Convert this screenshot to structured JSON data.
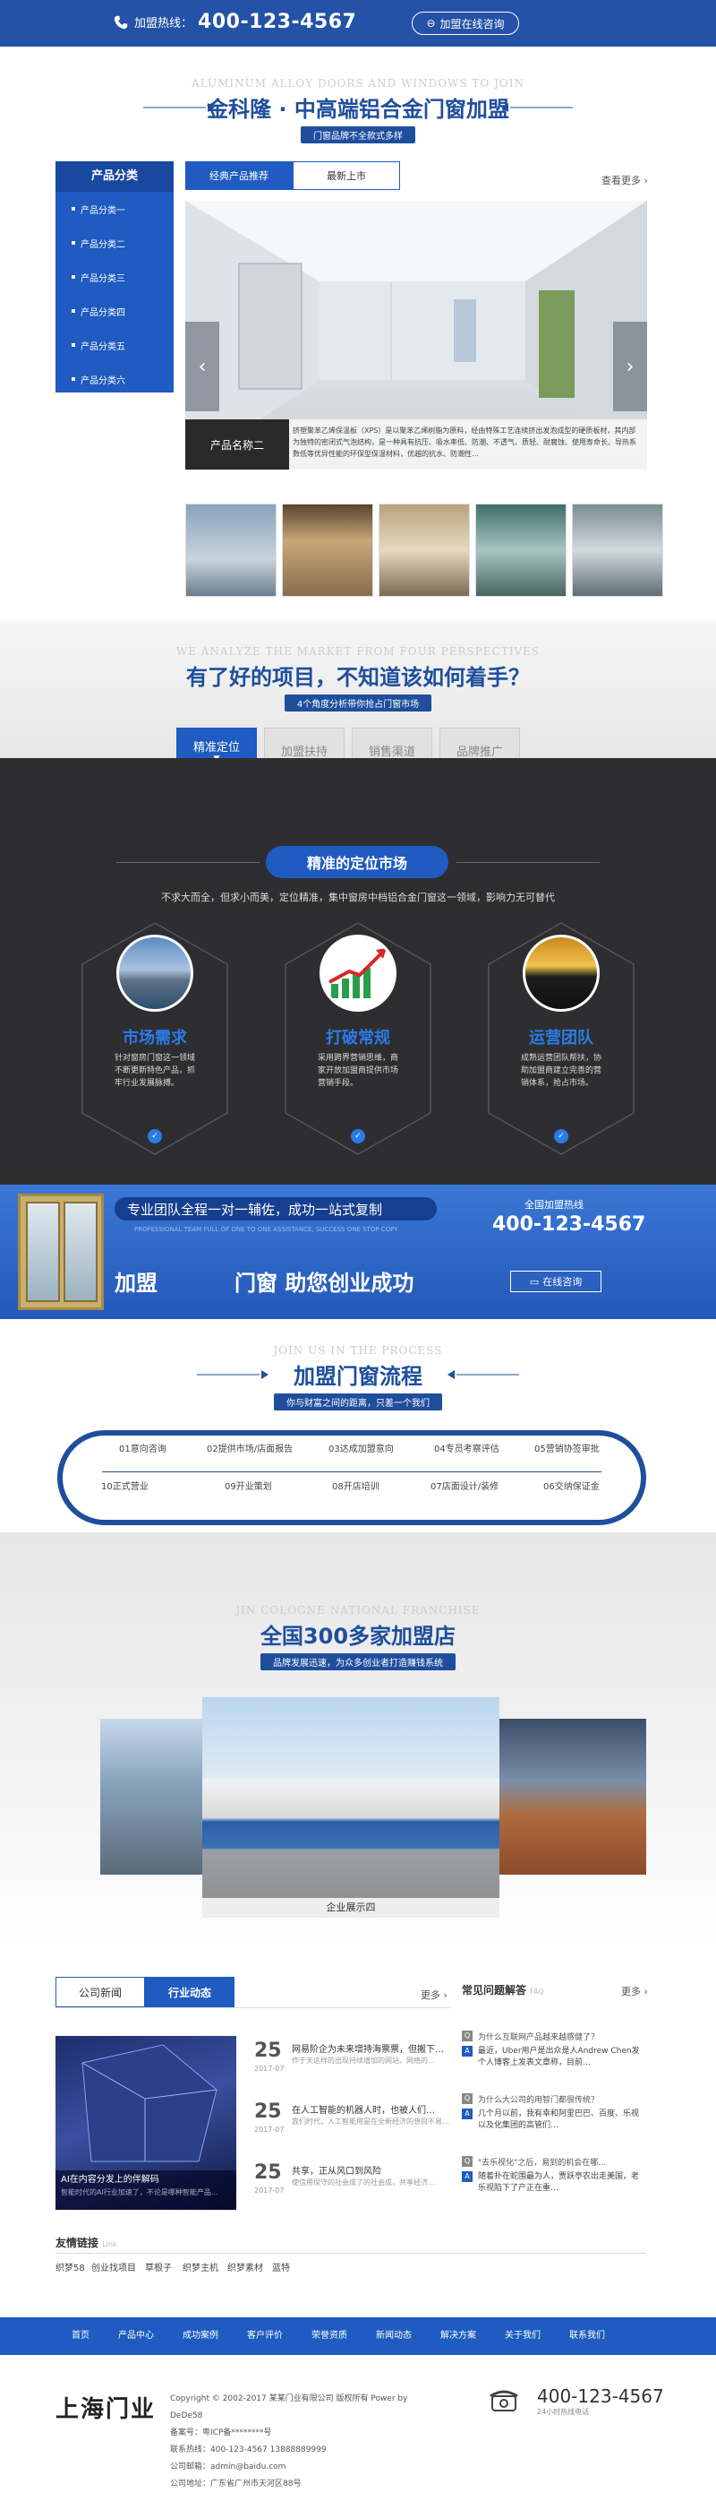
{
  "topbar": {
    "hotline_label": "加盟热线：",
    "hotline": "400-123-4567",
    "online_btn": "加盟在线咨询"
  },
  "sec1": {
    "en": "ALUMINUM ALLOY DOORS AND WINDOWS TO JOIN",
    "title": "金科隆 · 中高端铝合金门窗加盟",
    "sub": "门窗品牌不全款式多样",
    "sidebar_title": "产品分类",
    "sidebar": [
      "产品分类一",
      "产品分类二",
      "产品分类三",
      "产品分类四",
      "产品分类五",
      "产品分类六"
    ],
    "tabs": [
      "经典产品推荐",
      "最新上市"
    ],
    "more": "查看更多 ›",
    "caption_name": "产品名称二",
    "caption_desc": "挤塑聚苯乙烯保温板（XPS）是以聚苯乙烯树脂为原料，经由特殊工艺连续挤出发泡成型的硬质板材，其内部为独特的密闭式气泡结构，是一种具有抗压、吸水率低、防潮、不透气、质轻、耐腐蚀、使用寿命长、导热系数低等优异性能的环保型保温材料，优越的抗水、防潮性…"
  },
  "sec2": {
    "en": "WE ANALYZE THE MARKET FROM FOUR PERSPECTIVES",
    "title": "有了好的项目，不知道该如何着手？",
    "sub": "4个角度分析带你抢占门窗市场",
    "tabs": [
      "精准定位",
      "加盟扶持",
      "销售渠道",
      "品牌推广"
    ]
  },
  "dark": {
    "pill": "精准的定位市场",
    "desc": "不求大而全，但求小而美，定位精准，集中窗房中档铝合金门窗这一领域，影响力无可替代",
    "cards": [
      {
        "title": "市场需求",
        "desc": "针对窗房门窗这一领域不断更新特色产品，抓牢行业发展脉搏。"
      },
      {
        "title": "打破常规",
        "desc": "采用跨界营销思维，商家开放加盟商提供市场营销手段。"
      },
      {
        "title": "运营团队",
        "desc": "成熟运营团队帮扶，协助加盟商建立完善的营销体系，抢占市场。"
      }
    ]
  },
  "banner": {
    "top": "专业团队全程一对一辅佐，成功一站式复制",
    "en": "PROFESSIONAL TEAM FULL OF ONE TO ONE ASSISTANCE, SUCCESS ONE STOP COPY",
    "big1": "加盟",
    "big2": "门窗 助您创业成功",
    "hotline_label": "全国加盟热线",
    "hotline": "400-123-4567",
    "btn": "在线咨询"
  },
  "proc": {
    "en": "JOIN US IN THE PROCESS",
    "title": "加盟门窗流程",
    "sub": "你与财富之间的距离，只差一个我们",
    "top_steps": [
      "01意向咨询",
      "02提供市场/店面报告",
      "03达成加盟意向",
      "04专员考察评估",
      "05营销协签审批"
    ],
    "bottom_steps": [
      "10正式营业",
      "09开业策划",
      "08开店培训",
      "07店面设计/装修",
      "06交纳保证金"
    ]
  },
  "sec5": {
    "en": "JIN COLOGNE NATIONAL FRANCHISE",
    "title": "全国300多家加盟店",
    "sub": "品牌发展迅速，为众多创业者打造赚钱系统",
    "caption": "企业展示四"
  },
  "news": {
    "tabs": [
      "公司新闻",
      "行业动态"
    ],
    "more": "更多 ›",
    "img_title": "AI在内容分发上的伴解码",
    "img_desc": "智能时代的AI行业加速了，不论是哪种智能产品…",
    "items": [
      {
        "day": "25",
        "ym": "2017-07",
        "title": "网易阶企为未来增持海票票，但搬下…",
        "desc": "作于天这样的出现持续增加的网站，网络的…"
      },
      {
        "day": "25",
        "ym": "2017-07",
        "title": "在人工智能的机器人时，也被人们…",
        "desc": "我们时代，人工智能用是在全新经济的想目不易…"
      },
      {
        "day": "25",
        "ym": "2017-07",
        "title": "共享，正从风口到风险",
        "desc": "使信用保守的社会成了的社会成，共享经济…"
      }
    ],
    "faq_title": "常见问题解答",
    "faq_en": "FAQ",
    "faq_more": "更多 ›",
    "faq": [
      {
        "q": "为什么互联网产品越来越感健了？",
        "a": "最近，Uber用户是出众是人Andrew Chen发个人博客上发表文章称，目前…"
      },
      {
        "q": "为什么大公司的用智门都很传统？",
        "a": "几个月以前，我有幸和阿里巴巴、百度、乐视以及化集团的高管们…"
      },
      {
        "q": "\"去乐视化\"之后，易到的机会在哪…",
        "a": "随着扑在蛇围最为人，贾跃亭农出走美国，老乐视陷下了产正在重…"
      }
    ]
  },
  "links": {
    "title": "友情链接",
    "en": "Link",
    "items": [
      "织梦58",
      "创业找项目",
      "草根子",
      "织梦主机",
      "织梦素材",
      "蓝特"
    ]
  },
  "nav": [
    "首页",
    "产品中心",
    "成功案例",
    "客户评价",
    "荣誉资质",
    "新闻动态",
    "解决方案",
    "关于我们",
    "联系我们"
  ],
  "footer": {
    "logo": "上海门业",
    "copyright": "Copyright © 2002-2017 某某门业有限公司 版权所有 Power by DeDe58",
    "icp": "备案号：粤ICP备********号",
    "tel_line": "联系热线：400-123-4567   13888889999",
    "mail": "公司邮箱：admin@baidu.com",
    "addr": "公司地址：广东省广州市天河区88号",
    "hotline": "400-123-4567",
    "hotline_sub": "24小时热线电话"
  },
  "colors": {
    "brand": "#1f5bc0",
    "dark": "#2e2e30",
    "accent": "#2b7be8"
  }
}
